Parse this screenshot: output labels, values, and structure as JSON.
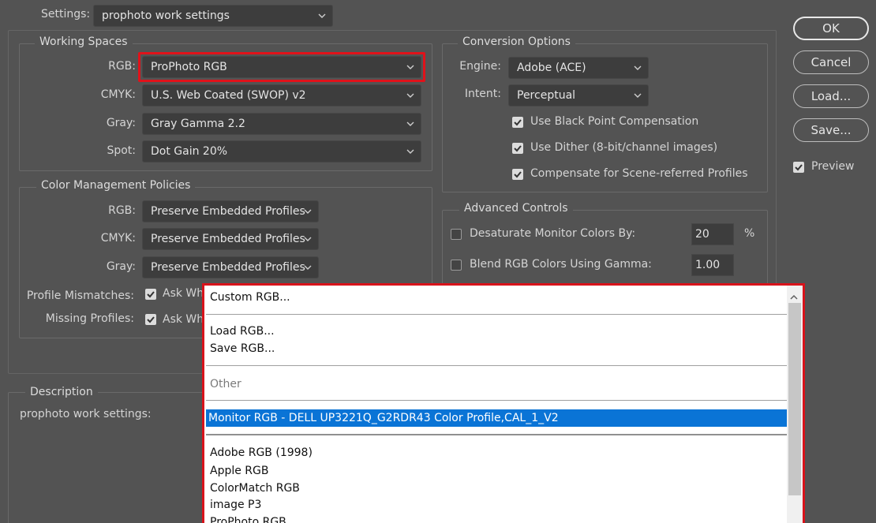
{
  "settings": {
    "label": "Settings:",
    "value": "prophoto work settings"
  },
  "working_spaces": {
    "title": "Working Spaces",
    "rgb": {
      "label": "RGB:",
      "value": "ProPhoto RGB"
    },
    "cmyk": {
      "label": "CMYK:",
      "value": "U.S. Web Coated (SWOP) v2"
    },
    "gray": {
      "label": "Gray:",
      "value": "Gray Gamma 2.2"
    },
    "spot": {
      "label": "Spot:",
      "value": "Dot Gain 20%"
    }
  },
  "policies": {
    "title": "Color Management Policies",
    "rgb": {
      "label": "RGB:",
      "value": "Preserve Embedded Profiles"
    },
    "cmyk": {
      "label": "CMYK:",
      "value": "Preserve Embedded Profiles"
    },
    "gray": {
      "label": "Gray:",
      "value": "Preserve Embedded Profiles"
    },
    "mismatch": {
      "label": "Profile Mismatches:",
      "check_text": "Ask Wh"
    },
    "missing": {
      "label": "Missing Profiles:",
      "check_text": "Ask Wh"
    }
  },
  "conversion": {
    "title": "Conversion Options",
    "engine": {
      "label": "Engine:",
      "value": "Adobe (ACE)"
    },
    "intent": {
      "label": "Intent:",
      "value": "Perceptual"
    },
    "black_point": "Use Black Point Compensation",
    "dither": "Use Dither (8-bit/channel images)",
    "scene": "Compensate for Scene-referred Profiles"
  },
  "advanced": {
    "title": "Advanced Controls",
    "desaturate": {
      "label": "Desaturate Monitor Colors By:",
      "value": "20",
      "unit": "%"
    },
    "blend": {
      "label": "Blend RGB Colors Using Gamma:",
      "value": "1.00"
    }
  },
  "description": {
    "title": "Description",
    "text": "prophoto work settings:"
  },
  "buttons": {
    "ok": "OK",
    "cancel": "Cancel",
    "load": "Load...",
    "save": "Save...",
    "preview": "Preview"
  },
  "dropdown": {
    "custom": "Custom RGB...",
    "load": "Load RGB...",
    "save": "Save RGB...",
    "other": "Other",
    "monitor": "Monitor RGB - DELL UP3221Q_G2RDR43 Color Profile,CAL_1_V2",
    "profiles": [
      "Adobe RGB (1998)",
      "Apple RGB",
      "ColorMatch RGB",
      "image P3",
      "ProPhoto RGB"
    ]
  },
  "colors": {
    "highlight": "#e0121a",
    "selection": "#0a74d6",
    "dialog_bg": "#535353"
  }
}
